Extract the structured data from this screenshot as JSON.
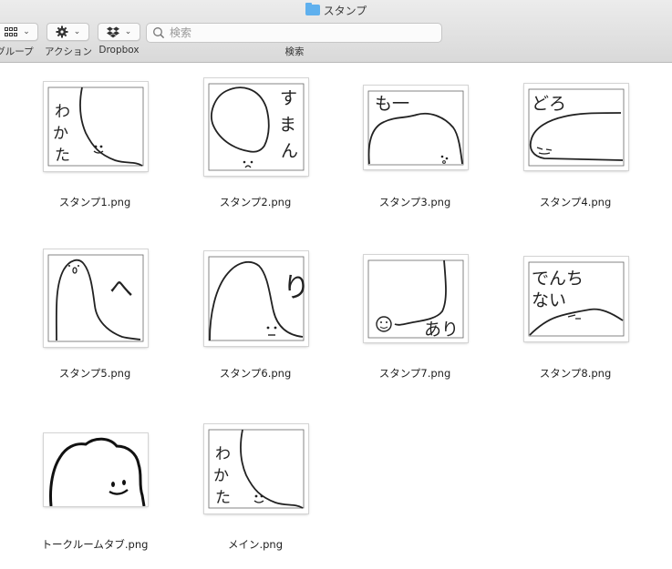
{
  "window": {
    "title": "スタンプ",
    "folder_icon": "folder-icon"
  },
  "toolbar": {
    "group_label": "グループ",
    "action_label": "アクション",
    "dropbox_label": "Dropbox",
    "search_label": "検索",
    "search_placeholder": "検索"
  },
  "files": [
    {
      "name": "スタンプ1.png"
    },
    {
      "name": "スタンプ2.png"
    },
    {
      "name": "スタンプ3.png"
    },
    {
      "name": "スタンプ4.png"
    },
    {
      "name": "スタンプ5.png"
    },
    {
      "name": "スタンプ6.png"
    },
    {
      "name": "スタンプ7.png"
    },
    {
      "name": "スタンプ8.png"
    },
    {
      "name": "トークルームタブ.png"
    },
    {
      "name": "メイン.png"
    }
  ],
  "stamp_text": {
    "s1": [
      "わ",
      "か",
      "た"
    ],
    "s2": [
      "す",
      "ま",
      "ん"
    ],
    "s3": "も一",
    "s4": "どろ",
    "s5": "へ",
    "s6": "り",
    "s7": "あり",
    "s8": [
      "でんち",
      "ない"
    ],
    "s10": [
      "わ",
      "か",
      "た"
    ]
  }
}
